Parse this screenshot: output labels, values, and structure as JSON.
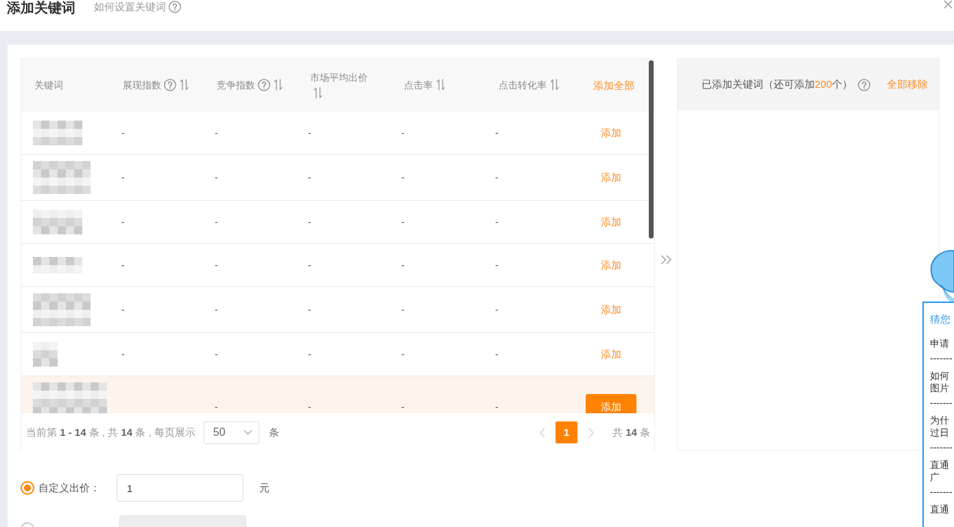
{
  "header": {
    "title": "添加关键词",
    "help_link": "如何设置关键词"
  },
  "keyword_table": {
    "columns": [
      {
        "label": "关键词",
        "help": false,
        "sortable": false
      },
      {
        "label": "展现指数",
        "help": true,
        "sortable": true
      },
      {
        "label": "竞争指数",
        "help": true,
        "sortable": true
      },
      {
        "label": "市场平均出价",
        "help": false,
        "sortable": true
      },
      {
        "label": "点击率",
        "help": false,
        "sortable": true
      },
      {
        "label": "点击转化率",
        "help": false,
        "sortable": true
      }
    ],
    "add_all": "添加全部",
    "rows": [
      {
        "cells": [
          "-",
          "-",
          "-",
          "-",
          "-"
        ],
        "action": "添加",
        "highlighted": false
      },
      {
        "cells": [
          "-",
          "-",
          "-",
          "-",
          "-"
        ],
        "action": "添加",
        "highlighted": false
      },
      {
        "cells": [
          "-",
          "-",
          "-",
          "-",
          "-"
        ],
        "action": "添加",
        "highlighted": false
      },
      {
        "cells": [
          "-",
          "-",
          "-",
          "-",
          "-"
        ],
        "action": "添加",
        "highlighted": false
      },
      {
        "cells": [
          "-",
          "-",
          "-",
          "-",
          "-"
        ],
        "action": "添加",
        "highlighted": false
      },
      {
        "cells": [
          "-",
          "-",
          "-",
          "-",
          "-"
        ],
        "action": "添加",
        "highlighted": false
      },
      {
        "cells": [
          null,
          "-",
          "-",
          "-",
          "-"
        ],
        "action": "添加",
        "highlighted": true
      }
    ],
    "pagination": {
      "summary": "当前第 **1 - 14** 条 , 共 **14** 条 , 每页展示",
      "page_size": "50",
      "page_size_unit": "条",
      "prev_disabled": true,
      "pages": [
        {
          "label": "1",
          "selected": true
        }
      ],
      "next_disabled": true,
      "total": "共 **14** 条"
    }
  },
  "added_panel": {
    "title_before": "已添加关键词（还可添加",
    "title_count": "200",
    "title_after": "个）",
    "remove_all": "全部移除"
  },
  "bid_options": [
    {
      "label": "自定义出价：",
      "selected": true,
      "value": "1",
      "unit": "元",
      "disabled": false
    },
    {
      "selected": false,
      "disabled": true
    }
  ],
  "help_popup": {
    "title": "猜您",
    "entries": [
      {
        "kind": "question",
        "lines": [
          "申请"
        ]
      },
      {
        "kind": "separator",
        "text": "-------"
      },
      {
        "kind": "question",
        "lines": [
          "如何",
          "图片"
        ]
      },
      {
        "kind": "separator",
        "text": "-------"
      },
      {
        "kind": "question",
        "lines": [
          "为什",
          "过日"
        ]
      },
      {
        "kind": "separator",
        "text": "-------"
      },
      {
        "kind": "question",
        "lines": [
          "直通",
          "广"
        ]
      },
      {
        "kind": "separator",
        "text": "-------"
      },
      {
        "kind": "question",
        "lines": [
          "直通"
        ]
      }
    ]
  }
}
